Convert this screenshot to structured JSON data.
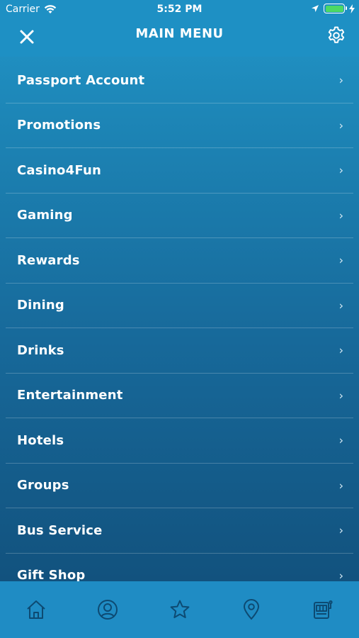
{
  "status_bar": {
    "carrier": "Carrier",
    "time": "5:52 PM"
  },
  "header": {
    "title": "MAIN MENU"
  },
  "menu": {
    "items": [
      {
        "label": "Passport Account"
      },
      {
        "label": "Promotions"
      },
      {
        "label": "Casino4Fun"
      },
      {
        "label": "Gaming"
      },
      {
        "label": "Rewards"
      },
      {
        "label": "Dining"
      },
      {
        "label": "Drinks"
      },
      {
        "label": "Entertainment"
      },
      {
        "label": "Hotels"
      },
      {
        "label": "Groups"
      },
      {
        "label": "Bus Service"
      },
      {
        "label": "Gift Shop"
      }
    ],
    "chevron": "›"
  },
  "tab_bar": {
    "icons": [
      "home-icon",
      "profile-icon",
      "star-icon",
      "location-pin-icon",
      "slot-machine-icon"
    ]
  },
  "colors": {
    "accent": "#1e90c4",
    "battery": "#4cd964"
  }
}
